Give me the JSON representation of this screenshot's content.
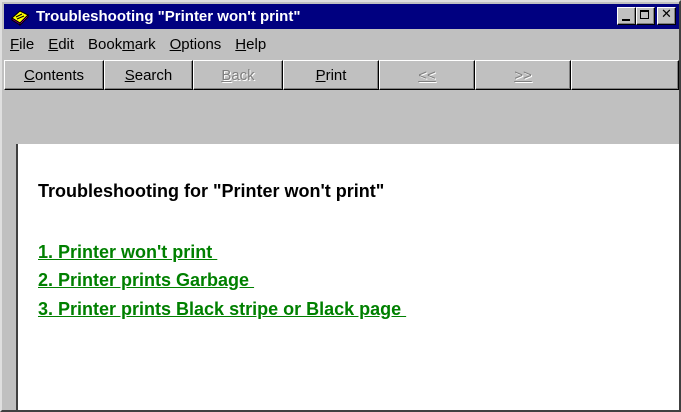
{
  "window": {
    "title": "Troubleshooting \"Printer won't print\""
  },
  "menu": {
    "items": [
      {
        "pre": "",
        "accel": "F",
        "post": "ile"
      },
      {
        "pre": "",
        "accel": "E",
        "post": "dit"
      },
      {
        "pre": "Book",
        "accel": "m",
        "post": "ark"
      },
      {
        "pre": "",
        "accel": "O",
        "post": "ptions"
      },
      {
        "pre": "",
        "accel": "H",
        "post": "elp"
      }
    ]
  },
  "toolbar": {
    "contents": {
      "accel": "C",
      "post": "ontents"
    },
    "search": {
      "accel": "S",
      "post": "earch"
    },
    "back": {
      "accel": "B",
      "post": "ack"
    },
    "print": {
      "accel": "P",
      "post": "rint"
    },
    "prev": {
      "label": "<<"
    },
    "next": {
      "label": ">>"
    }
  },
  "content": {
    "heading": "Troubleshooting for \"Printer won't print\"",
    "links": [
      "1. Printer won't print ",
      "2. Printer prints Garbage ",
      "3. Printer prints Black stripe or Black page "
    ]
  },
  "colors": {
    "titlebar": "#000080",
    "link": "#008000",
    "face": "#c0c0c0"
  },
  "icons": {
    "app": "help-book-icon",
    "minimize": "minimize-icon",
    "maximize": "maximize-icon",
    "close": "close-icon"
  }
}
